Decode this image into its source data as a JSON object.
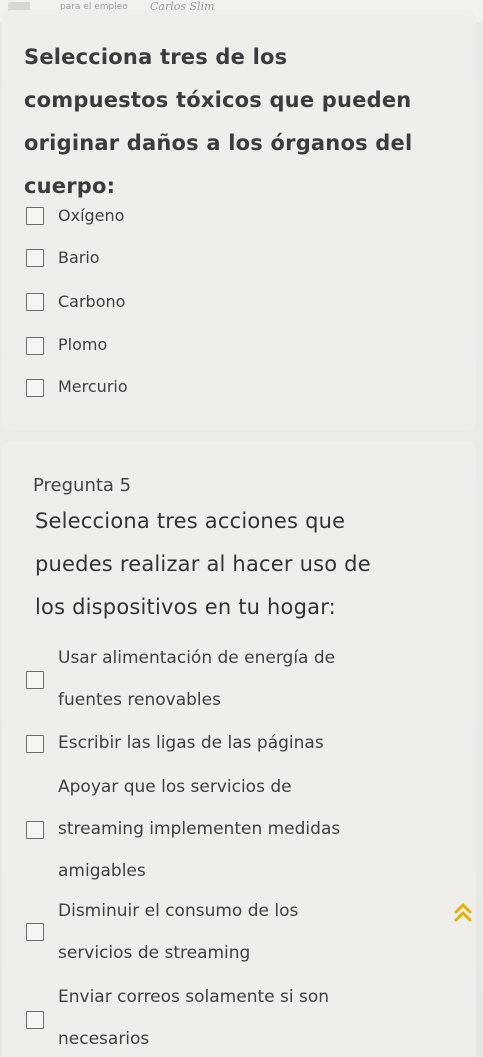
{
  "header": {
    "small_text": "para el empleo",
    "signature_text": "Carlos Slim"
  },
  "question_a": {
    "title_lines": [
      "Selecciona tres de los",
      "compuestos tóxicos que pueden",
      "originar daños a los órganos del",
      "cuerpo:"
    ],
    "options": [
      "Oxígeno",
      "Bario",
      "Carbono",
      "Plomo",
      "Mercurio"
    ]
  },
  "question_b": {
    "label": "Pregunta 5",
    "title_lines": [
      "Selecciona tres acciones que",
      "puedes realizar al hacer uso de",
      "los dispositivos en tu hogar:"
    ],
    "options": [
      {
        "lines": [
          "Usar alimentación de energía de",
          "fuentes renovables"
        ]
      },
      {
        "lines": [
          "Escribir las ligas de las páginas"
        ]
      },
      {
        "lines": [
          "Apoyar que los servicios de",
          "streaming implementen medidas",
          "amigables"
        ]
      },
      {
        "lines": [
          "Disminuir el consumo de los",
          "servicios de streaming"
        ]
      },
      {
        "lines": [
          "Enviar correos solamente si son",
          "necesarios"
        ]
      }
    ]
  },
  "icons": {
    "scroll_top": "double-chevron-up-icon",
    "scroll_top_color": "#e0b400"
  }
}
